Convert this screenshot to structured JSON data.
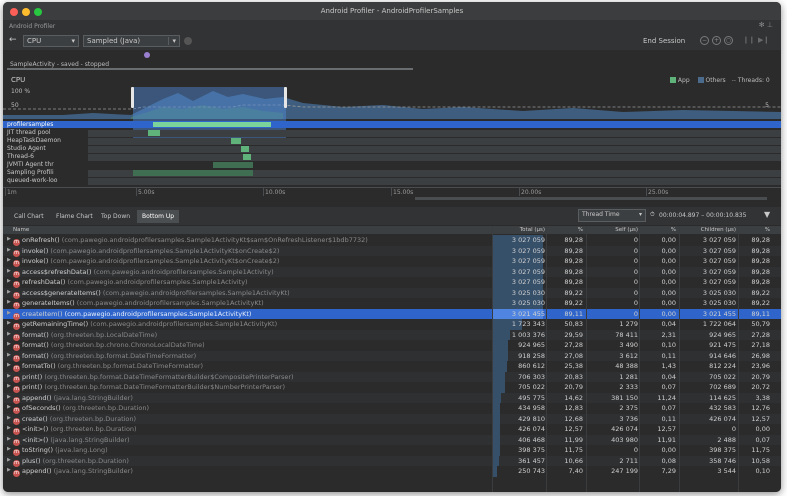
{
  "window_title": "Android Profiler - AndroidProfilerSamples",
  "panel_title": "Android Profiler",
  "toolbar": {
    "back": "←",
    "profiler_select": "CPU",
    "config_select": "Sampled (Java)",
    "end_session": "End Session"
  },
  "activity_label": "SampleActivity - saved - stopped",
  "cpu": {
    "label": "CPU",
    "pct_100": "100 %",
    "pct_50": "50",
    "legend_app": "App",
    "legend_others": "Others",
    "legend_threads": "Threads: 0",
    "right_pct": "5"
  },
  "threads": [
    {
      "name": "profilersamples",
      "selected": true
    },
    {
      "name": "JIT thread pool",
      "selected": false
    },
    {
      "name": "HeapTaskDaemon",
      "selected": false
    },
    {
      "name": "Studio Agent",
      "selected": false
    },
    {
      "name": "Thread-6",
      "selected": false
    },
    {
      "name": "JVMTI Agent thr",
      "selected": false
    },
    {
      "name": "Sampling Profili",
      "selected": false
    },
    {
      "name": "queued-work-loo",
      "selected": false
    }
  ],
  "timeline": [
    "1m",
    "5.00s",
    "10.00s",
    "15.00s",
    "20.00s",
    "25.00s"
  ],
  "tabs": [
    "Call Chart",
    "Flame Chart",
    "Top Down",
    "Bottom Up"
  ],
  "active_tab": "Bottom Up",
  "thread_time": "Thread Time",
  "time_range": "00:00:04.897 – 00:00:10.835",
  "columns": {
    "name": "Name",
    "total": "Total (µs)",
    "pct1": "%",
    "self": "Self (µs)",
    "pct2": "%",
    "children": "Children (µs)",
    "pct3": "%"
  },
  "rows": [
    {
      "method": "onRefresh()",
      "pkg": "(com.pawegio.androidprofilersamples.Sample1ActivityKt$sam$OnRefreshListener$1bdb7732)",
      "total": "3 027 059",
      "tp": "89,28",
      "self": "0",
      "sp": "0,00",
      "children": "3 027 059",
      "cp": "89,28",
      "bar": 0.89
    },
    {
      "method": "invoke()",
      "pkg": "(com.pawegio.androidprofilersamples.Sample1ActivityKt$onCreate$2)",
      "total": "3 027 059",
      "tp": "89,28",
      "self": "0",
      "sp": "0,00",
      "children": "3 027 059",
      "cp": "89,28",
      "bar": 0.89
    },
    {
      "method": "invoke()",
      "pkg": "(com.pawegio.androidprofilersamples.Sample1ActivityKt$onCreate$2)",
      "total": "3 027 059",
      "tp": "89,28",
      "self": "0",
      "sp": "0,00",
      "children": "3 027 059",
      "cp": "89,28",
      "bar": 0.89
    },
    {
      "method": "access$refreshData()",
      "pkg": "(com.pawegio.androidprofilersamples.Sample1Activity)",
      "total": "3 027 059",
      "tp": "89,28",
      "self": "0",
      "sp": "0,00",
      "children": "3 027 059",
      "cp": "89,28",
      "bar": 0.89
    },
    {
      "method": "refreshData()",
      "pkg": "(com.pawegio.androidprofilersamples.Sample1Activity)",
      "total": "3 027 059",
      "tp": "89,28",
      "self": "0",
      "sp": "0,00",
      "children": "3 027 059",
      "cp": "89,28",
      "bar": 0.89
    },
    {
      "method": "access$generateItems()",
      "pkg": "(com.pawegio.androidprofilersamples.Sample1ActivityKt)",
      "total": "3 025 030",
      "tp": "89,22",
      "self": "0",
      "sp": "0,00",
      "children": "3 025 030",
      "cp": "89,22",
      "bar": 0.89
    },
    {
      "method": "generateItems()",
      "pkg": "(com.pawegio.androidprofilersamples.Sample1ActivityKt)",
      "total": "3 025 030",
      "tp": "89,22",
      "self": "0",
      "sp": "0,00",
      "children": "3 025 030",
      "cp": "89,22",
      "bar": 0.89
    },
    {
      "method": "createItem()",
      "pkg": "(com.pawegio.androidprofilersamples.Sample1ActivityKt)",
      "total": "3 021 455",
      "tp": "89,11",
      "self": "0",
      "sp": "0,00",
      "children": "3 021 455",
      "cp": "89,11",
      "bar": 0.89,
      "selected": true
    },
    {
      "method": "getRemainingTime()",
      "pkg": "(com.pawegio.androidprofilersamples.Sample1ActivityKt)",
      "total": "1 723 343",
      "tp": "50,83",
      "self": "1 279",
      "sp": "0,04",
      "children": "1 722 064",
      "cp": "50,79",
      "bar": 0.51
    },
    {
      "method": "format()",
      "pkg": "(org.threeten.bp.LocalDateTime)",
      "total": "1 003 376",
      "tp": "29,59",
      "self": "78 411",
      "sp": "2,31",
      "children": "924 965",
      "cp": "27,28",
      "bar": 0.3
    },
    {
      "method": "format()",
      "pkg": "(org.threeten.bp.chrono.ChronoLocalDateTime)",
      "total": "924 965",
      "tp": "27,28",
      "self": "3 490",
      "sp": "0,10",
      "children": "921 475",
      "cp": "27,18",
      "bar": 0.27
    },
    {
      "method": "format()",
      "pkg": "(org.threeten.bp.format.DateTimeFormatter)",
      "total": "918 258",
      "tp": "27,08",
      "self": "3 612",
      "sp": "0,11",
      "children": "914 646",
      "cp": "26,98",
      "bar": 0.27
    },
    {
      "method": "formatTo()",
      "pkg": "(org.threeten.bp.format.DateTimeFormatter)",
      "total": "860 612",
      "tp": "25,38",
      "self": "48 388",
      "sp": "1,43",
      "children": "812 224",
      "cp": "23,96",
      "bar": 0.25
    },
    {
      "method": "print()",
      "pkg": "(org.threeten.bp.format.DateTimeFormatterBuilder$CompositePrinterParser)",
      "total": "706 303",
      "tp": "20,83",
      "self": "1 281",
      "sp": "0,04",
      "children": "705 022",
      "cp": "20,79",
      "bar": 0.21
    },
    {
      "method": "print()",
      "pkg": "(org.threeten.bp.format.DateTimeFormatterBuilder$NumberPrinterParser)",
      "total": "705 022",
      "tp": "20,79",
      "self": "2 333",
      "sp": "0,07",
      "children": "702 689",
      "cp": "20,72",
      "bar": 0.21
    },
    {
      "method": "append()",
      "pkg": "(java.lang.StringBuilder)",
      "total": "495 775",
      "tp": "14,62",
      "self": "381 150",
      "sp": "11,24",
      "children": "114 625",
      "cp": "3,38",
      "bar": 0.15
    },
    {
      "method": "ofSeconds()",
      "pkg": "(org.threeten.bp.Duration)",
      "total": "434 958",
      "tp": "12,83",
      "self": "2 375",
      "sp": "0,07",
      "children": "432 583",
      "cp": "12,76",
      "bar": 0.13
    },
    {
      "method": "create()",
      "pkg": "(org.threeten.bp.Duration)",
      "total": "429 810",
      "tp": "12,68",
      "self": "3 736",
      "sp": "0,11",
      "children": "426 074",
      "cp": "12,57",
      "bar": 0.13
    },
    {
      "method": "<init>()",
      "pkg": "(org.threeten.bp.Duration)",
      "total": "426 074",
      "tp": "12,57",
      "self": "426 074",
      "sp": "12,57",
      "children": "0",
      "cp": "0,00",
      "bar": 0.13
    },
    {
      "method": "<init>()",
      "pkg": "(java.lang.StringBuilder)",
      "total": "406 468",
      "tp": "11,99",
      "self": "403 980",
      "sp": "11,91",
      "children": "2 488",
      "cp": "0,07",
      "bar": 0.12
    },
    {
      "method": "toString()",
      "pkg": "(java.lang.Long)",
      "total": "398 375",
      "tp": "11,75",
      "self": "0",
      "sp": "0,00",
      "children": "398 375",
      "cp": "11,75",
      "bar": 0.12
    },
    {
      "method": "plus()",
      "pkg": "(org.threeten.bp.Duration)",
      "total": "361 457",
      "tp": "10,66",
      "self": "2 711",
      "sp": "0,08",
      "children": "358 746",
      "cp": "10,58",
      "bar": 0.11
    },
    {
      "method": "append()",
      "pkg": "(java.lang.StringBuilder)",
      "total": "250 743",
      "tp": "7,40",
      "self": "247 199",
      "sp": "7,29",
      "children": "3 544",
      "cp": "0,10",
      "bar": 0.07
    }
  ],
  "colors": {
    "app": "#5fb37a",
    "others": "#4a6b8c",
    "selection": "#2f65ca",
    "method_icon": "#c75450"
  }
}
